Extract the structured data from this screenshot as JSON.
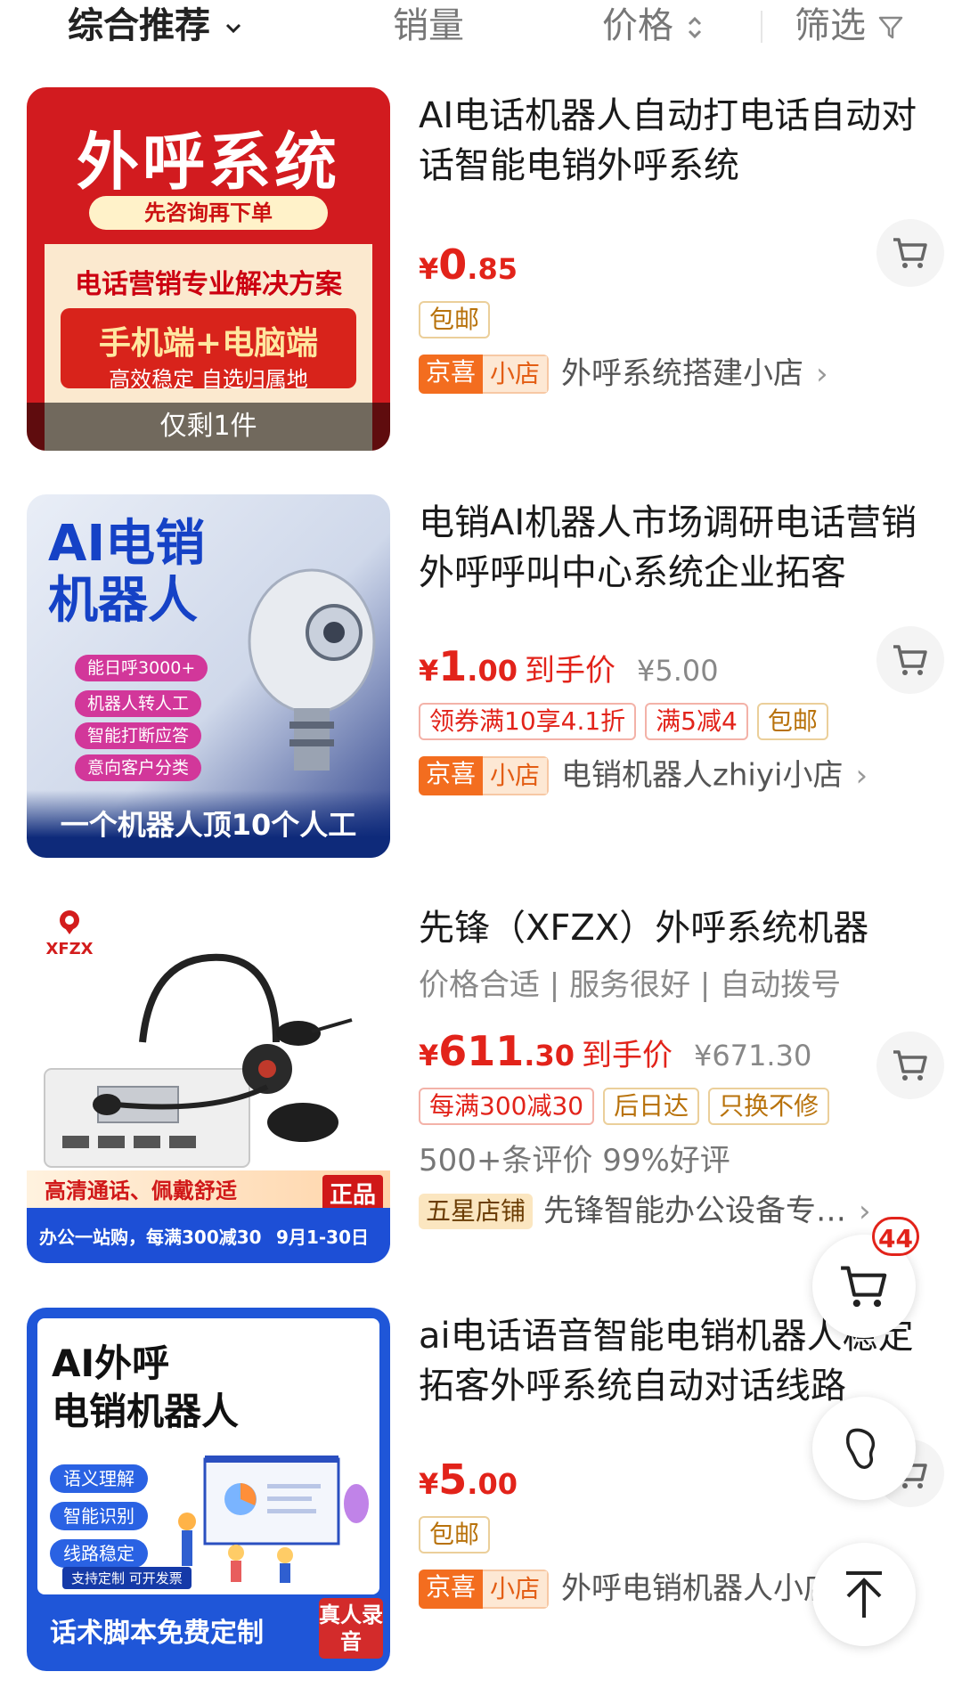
{
  "sort_bar": {
    "tabs": [
      {
        "label": "综合推荐"
      },
      {
        "label": "销量"
      },
      {
        "label": "价格"
      },
      {
        "label": "筛选"
      }
    ]
  },
  "products": [
    {
      "title": "AI电话机器人自动打电话自动对话智能电销外呼系统",
      "price_int": "0",
      "price_dec": ".85",
      "tags": [
        "包邮"
      ],
      "shop_badge": [
        "京喜",
        "小店"
      ],
      "shop_name": "外呼系统搭建小店",
      "thumb": {
        "headline": "外呼系统",
        "pill": "先咨询再下单",
        "line1": "电话营销专业解决方案",
        "line2": "手机端+电脑端",
        "line3": "高效稳定 自选归属地",
        "remaining": "仅剩1件"
      }
    },
    {
      "title": "电销AI机器人市场调研电话营销外呼呼叫中心系统企业拓客",
      "price_int": "1",
      "price_dec": ".00",
      "price_label": "到手价",
      "orig_price": "¥5.00",
      "tags": [
        "领券满10享4.1折",
        "满5减4",
        "包邮"
      ],
      "shop_badge": [
        "京喜",
        "小店"
      ],
      "shop_name": "电销机器人zhiyi小店",
      "thumb": {
        "headline_1": "AI电销",
        "headline_2": "机器人",
        "chips": [
          "能日呼3000+",
          "机器人转人工",
          "智能打断应答",
          "意向客户分类"
        ],
        "bottom": "一个机器人顶10个人工"
      }
    },
    {
      "title": "先锋（XFZX）外呼系统机器",
      "subtitle": "价格合适 | 服务很好 | 自动拨号",
      "price_int": "611",
      "price_dec": ".30",
      "price_label": "到手价",
      "orig_price": "¥671.30",
      "tags": [
        "每满300减30",
        "后日达",
        "只换不修"
      ],
      "stats": "500+条评价  99%好评",
      "shop_badge": [
        "五星店铺"
      ],
      "shop_name": "先锋智能办公设备专…",
      "thumb": {
        "logo": "XFZX",
        "band": "高清通话、佩戴舒适",
        "genuine": "正品",
        "promo": "办公一站购，每满300减30",
        "date": "9月1-30日"
      }
    },
    {
      "title": "ai电话语音智能电销机器人稳定拓客外呼系统自动对话线路",
      "price_int": "5",
      "price_dec": ".00",
      "tags": [
        "包邮"
      ],
      "shop_badge": [
        "京喜",
        "小店"
      ],
      "shop_name": "外呼电销机器人小店",
      "thumb": {
        "headline_1": "AI外呼",
        "headline_2": "电销机器人",
        "chips": [
          "语义理解",
          "智能识别",
          "线路稳定"
        ],
        "note": "支持定制 可开发票",
        "bottom": "话术脚本免费定制",
        "corner": "真人录音"
      }
    }
  ],
  "currency": "¥",
  "floating": {
    "cart_count": "44"
  },
  "colors": {
    "price_red": "#e2231a",
    "jx_orange": "#f36d1f"
  }
}
